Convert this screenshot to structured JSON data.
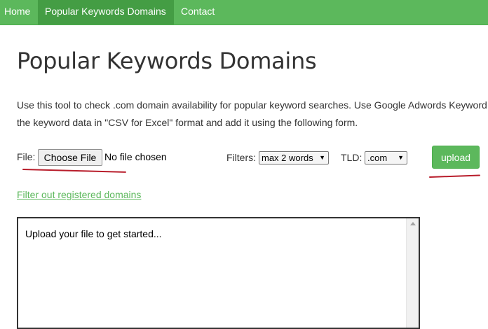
{
  "nav": {
    "items": [
      {
        "label": "Home"
      },
      {
        "label": "Popular Keywords Domains"
      },
      {
        "label": "Contact"
      }
    ]
  },
  "page": {
    "title": "Popular Keywords Domains",
    "description_line1": "Use this tool to check .com domain availability for popular keyword searches. Use Google Adwords Keyword",
    "description_line2": "the keyword data in \"CSV for Excel\" format and add it using the following form."
  },
  "form": {
    "file_label": "File:",
    "choose_file_label": "Choose File",
    "file_status": "No file chosen",
    "filters_label": "Filters:",
    "filter_selected": "max 2 words",
    "tld_label": "TLD:",
    "tld_selected": ".com",
    "upload_label": "upload",
    "filter_link": "Filter out registered domains"
  },
  "result": {
    "placeholder": "Upload your file to get started..."
  },
  "colors": {
    "brand": "#5cb85c",
    "active_nav": "#449d44",
    "annotation": "#b81d2b"
  }
}
